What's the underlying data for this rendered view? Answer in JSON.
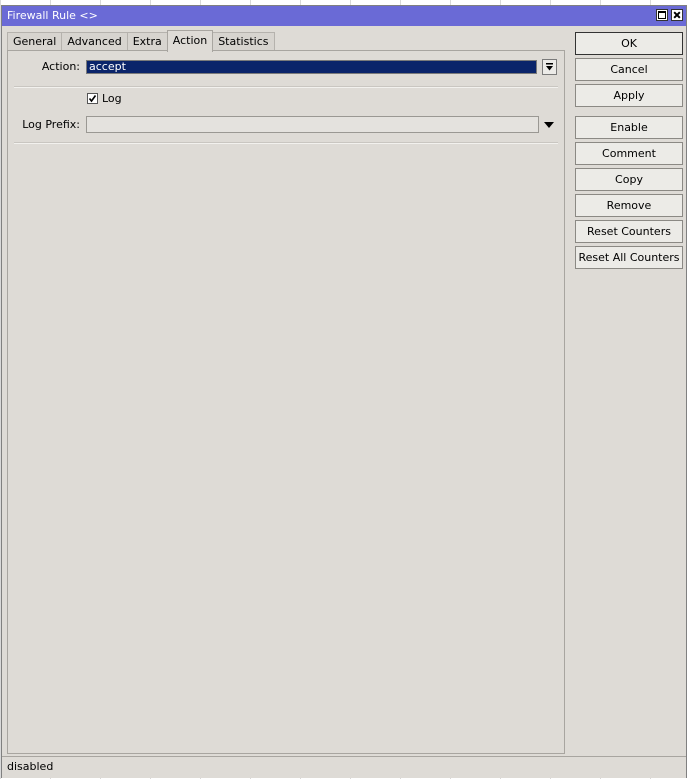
{
  "window": {
    "title": "Firewall Rule <>"
  },
  "tabs": [
    {
      "label": "General"
    },
    {
      "label": "Advanced"
    },
    {
      "label": "Extra"
    },
    {
      "label": "Action"
    },
    {
      "label": "Statistics"
    }
  ],
  "active_tab": "Action",
  "form": {
    "action_label": "Action:",
    "action_value": "accept",
    "log_label": "Log",
    "log_checked": true,
    "log_prefix_label": "Log Prefix:",
    "log_prefix_value": ""
  },
  "buttons": [
    {
      "label": "OK"
    },
    {
      "label": "Cancel"
    },
    {
      "label": "Apply"
    },
    {
      "label": "Enable"
    },
    {
      "label": "Comment"
    },
    {
      "label": "Copy"
    },
    {
      "label": "Remove"
    },
    {
      "label": "Reset Counters"
    },
    {
      "label": "Reset All Counters"
    }
  ],
  "status": {
    "text": "disabled"
  },
  "colors": {
    "titlebar": "#6a6ad6",
    "selection": "#0a246a",
    "window_bg": "#dedbd6"
  },
  "icons": {
    "maximize": "maximize-icon",
    "close": "close-icon",
    "dropdown": "dropdown-arrow-icon",
    "checkbox_check": "check-icon"
  }
}
